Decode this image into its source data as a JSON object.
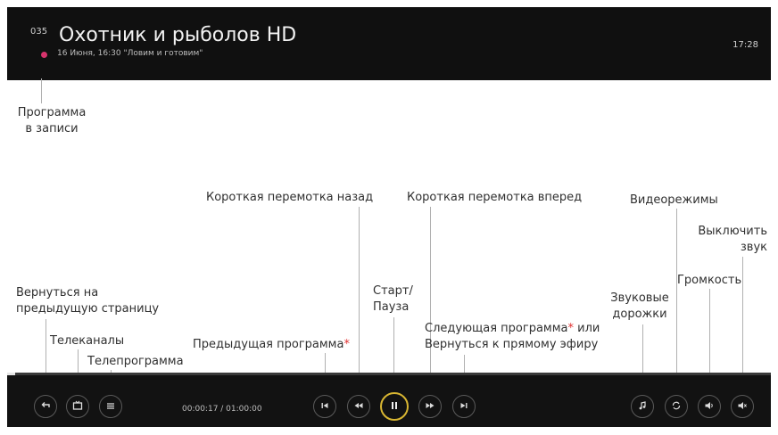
{
  "header": {
    "channel_number": "035",
    "channel_title": "Охотник и рыболов HD",
    "program_info": "16 Июня, 16:30   \"Ловим и готовим\"",
    "clock": "17:28"
  },
  "player": {
    "time": "00:00:17 / 01:00:00",
    "progress_fraction": 0.01,
    "accent_color": "#d8b632"
  },
  "annotations": {
    "recorded_line1": "Программа",
    "recorded_line2": "в записи",
    "back_line1": "Вернуться на",
    "back_line2": "предыдущую страницу",
    "channels": "Телеканалы",
    "epg": "Телепрограмма",
    "prev_program": "Предыдущая программа",
    "asterisk": "*",
    "rewind": "Короткая перемотка назад",
    "play_pause_line1": "Старт/",
    "play_pause_line2": "Пауза",
    "forward": "Короткая перемотка вперед",
    "next_program_line1": "Следующая программа",
    "next_program_or": " или",
    "next_program_line2": "Вернуться к прямому эфиру",
    "audio_tracks_line1": "Звуковые",
    "audio_tracks_line2": "дорожки",
    "video_modes": "Видеорежимы",
    "volume": "Громкость",
    "mute_line1": "Выключить",
    "mute_line2": "звук"
  },
  "icons": [
    "back-icon",
    "tv-icon",
    "guide-icon",
    "skip-previous-icon",
    "rewind-icon",
    "pause-icon",
    "fast-forward-icon",
    "skip-next-icon",
    "audio-track-icon",
    "video-mode-icon",
    "volume-icon",
    "mute-icon"
  ]
}
